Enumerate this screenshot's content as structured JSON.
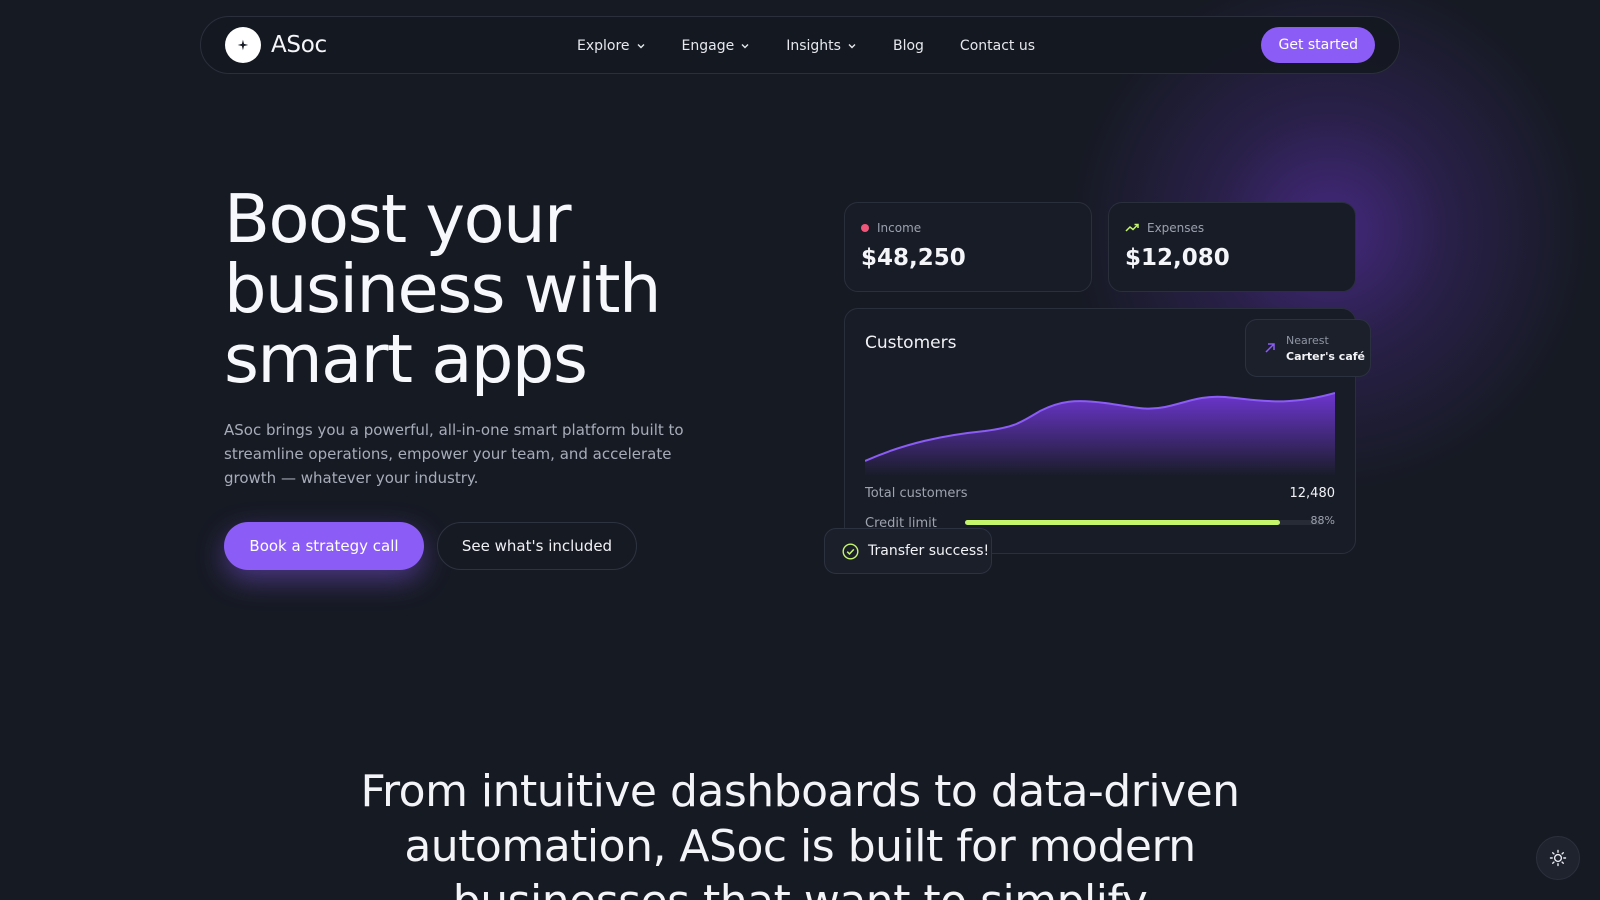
{
  "brand": {
    "name": "ASoc"
  },
  "nav": {
    "items": [
      {
        "label": "Explore",
        "has_dropdown": true
      },
      {
        "label": "Engage",
        "has_dropdown": true
      },
      {
        "label": "Insights",
        "has_dropdown": true
      },
      {
        "label": "Blog",
        "has_dropdown": false
      },
      {
        "label": "Contact us",
        "has_dropdown": false
      }
    ],
    "cta_label": "Get started"
  },
  "hero": {
    "title_line1": "Boost your",
    "title_line2": "business with",
    "title_line3": "smart apps",
    "description": "ASoc brings you a powerful, all-in-one smart platform built to streamline operations, empower your team, and accelerate growth — whatever your industry.",
    "primary_button": "Book a strategy call",
    "secondary_button": "See what's included"
  },
  "dashboard": {
    "income": {
      "label": "Income",
      "value": "$48,250",
      "dot_color": "#f0567a"
    },
    "expenses": {
      "label": "Expenses",
      "value": "$12,080",
      "icon": "trend-up-icon",
      "icon_color": "#c4f56b"
    },
    "customers": {
      "title": "Customers",
      "total_label": "Total customers",
      "total_value": "12,480",
      "credit_label": "Credit limit",
      "credit_percent_text": "88%",
      "credit_fraction": 0.88
    },
    "nearest": {
      "label": "Nearest",
      "value": "Carter's café"
    },
    "toast": {
      "text": "Transfer success!"
    }
  },
  "tagline": {
    "line1": "From intuitive dashboards to data-driven",
    "line2": "automation, ASoc is built for modern",
    "line3": "businesses that want to simplify"
  },
  "colors": {
    "accent": "#8b5cf6",
    "background": "#161a23",
    "lime": "#c4f56b"
  }
}
